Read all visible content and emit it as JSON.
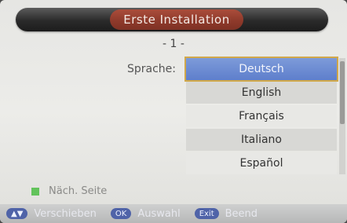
{
  "header": {
    "title": "Erste Installation"
  },
  "page_indicator": "- 1 -",
  "form": {
    "language_label": "Sprache:",
    "languages": [
      {
        "label": "Deutsch",
        "selected": true
      },
      {
        "label": "English"
      },
      {
        "label": "Français"
      },
      {
        "label": "Italiano"
      },
      {
        "label": "Español"
      }
    ]
  },
  "hint": {
    "text": "Näch. Seite"
  },
  "footer": {
    "move_label": "Verschieben",
    "select_label": "Auswahl",
    "exit_label": "Beend",
    "keys": {
      "move": "▲▼",
      "select": "OK",
      "exit": "Exit"
    }
  },
  "colors": {
    "selected": "#6c8ad3",
    "title_accent": "#8f3a2b",
    "hint_key": "#62c35b"
  }
}
